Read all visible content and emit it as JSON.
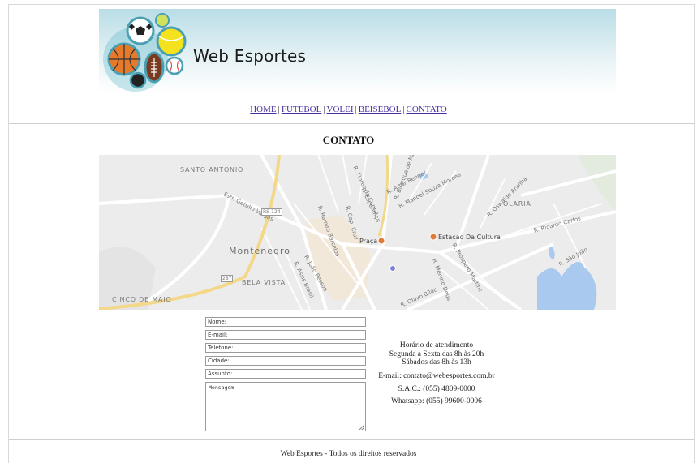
{
  "brand": {
    "name": "Web Esportes"
  },
  "nav": {
    "items": [
      {
        "label": "HOME"
      },
      {
        "label": "FUTEBOL"
      },
      {
        "label": "VOLEI"
      },
      {
        "label": "BEISEBOL"
      },
      {
        "label": "CONTATO"
      }
    ],
    "separator": "|"
  },
  "page": {
    "title": "CONTATO"
  },
  "map": {
    "labels": {
      "santo_antonio": "SANTO ANTONIO",
      "montenegro": "Montenegro",
      "bela_vista": "BELA VISTA",
      "cinco_de_maio": "CINCO DE MAIO",
      "olaria": "OLARIA",
      "praca": "Praça",
      "estacao": "Estacao Da Cultura",
      "getulio": "Estr. Getúlio Vargas",
      "rs124": "RS-124",
      "r287": "287",
      "ramiro": "R. Ramiro Barcelos",
      "joao_pessoa": "R. João Pessoa",
      "assis": "R. Assis Brasil",
      "artur": "R. Artur Renner",
      "manoel": "R. Manoel Souza Moraes",
      "oswaldo": "R. Oswaldo Aranha",
      "prospero": "R. Próspero Martins",
      "olavo": "R. Olavo Bilac",
      "sao_joao": "R. São João",
      "ricardo": "R. Ricardo Carlos",
      "capcruz": "R. Cap. Cruz",
      "menino": "R. Menino Deus",
      "esperanca": "R. Esperança",
      "flores": "R. Flores da Cunha",
      "buarque": "R. Buarque de Macedo"
    }
  },
  "form": {
    "nome": "Nome:",
    "email": "E-mail:",
    "telefone": "Telefone:",
    "cidade": "Cidade:",
    "assunto": "Assunto:",
    "mensagem": "Mensagem"
  },
  "info": {
    "horario_title": "Horário de atendimento",
    "horario_semana": "Segunda a Sexta das 8h às 20h",
    "horario_sabado": "Sábados das 8h às 13h",
    "email": "E-mail: contato@webesportes.com.br",
    "sac": "S.A.C.: (055) 4809-0000",
    "whatsapp": "Whatsapp: (055) 99600-0006"
  },
  "footer": {
    "text": "Web Esportes - Todos os direitos reservados"
  }
}
